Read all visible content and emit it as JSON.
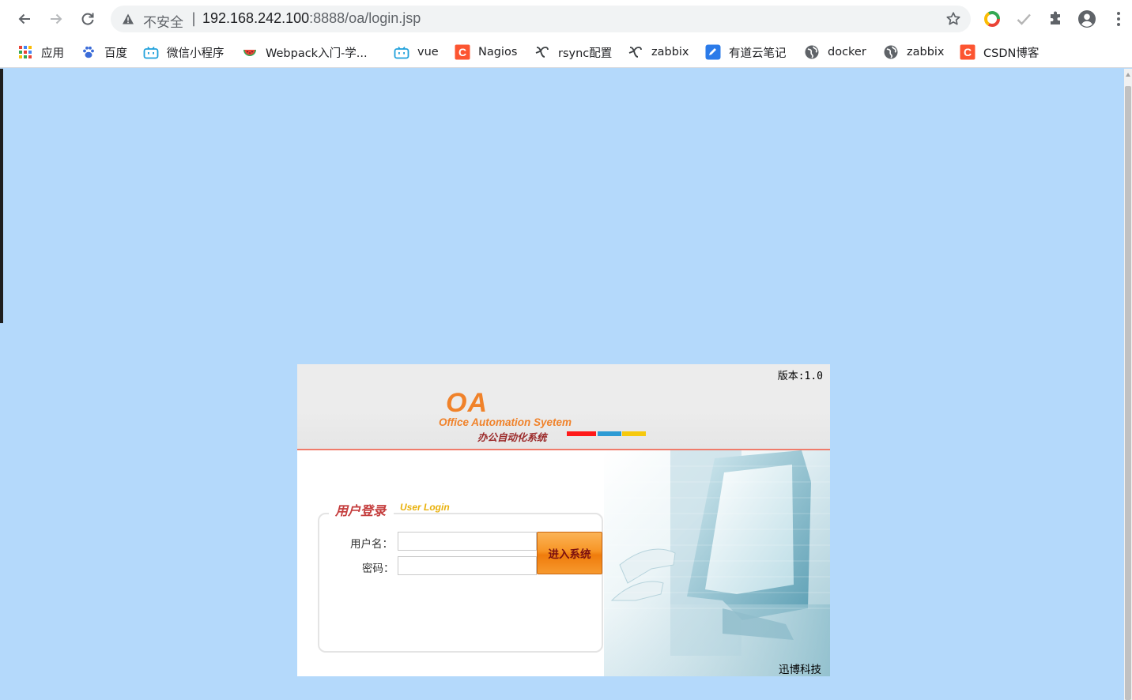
{
  "browser": {
    "security_label": "不安全",
    "separator": "|",
    "url_host": "192.168.242.100",
    "url_rest": ":8888/oa/login.jsp"
  },
  "bookmarks": [
    {
      "label": "应用",
      "icon": "apps-grid-icon"
    },
    {
      "label": "百度",
      "icon": "baidu-paw-icon"
    },
    {
      "label": "微信小程序",
      "icon": "bilibili-tv-icon"
    },
    {
      "label": "Webpack入门-学...",
      "icon": "watermelon-icon"
    },
    {
      "label": "vue",
      "icon": "bilibili-tv-icon"
    },
    {
      "label": "Nagios",
      "icon": "csdn-c-icon"
    },
    {
      "label": "rsync配置",
      "icon": "linux-zeal-icon"
    },
    {
      "label": "zabbix",
      "icon": "linux-zeal-icon"
    },
    {
      "label": "有道云笔记",
      "icon": "youdao-note-icon"
    },
    {
      "label": "docker",
      "icon": "globe-icon"
    },
    {
      "label": "zabbix",
      "icon": "globe-icon"
    },
    {
      "label": "CSDN博客",
      "icon": "csdn-c-icon"
    }
  ],
  "login": {
    "version": "版本:1.0",
    "logo_text": "OA",
    "logo_subtitle_en": "Office Automation Syetem",
    "logo_subtitle_cn": "办公自动化系统",
    "title_cn": "用户登录",
    "title_en": "User Login",
    "username_label": "用户名：",
    "password_label": "密码：",
    "username_value": "",
    "password_value": "",
    "submit_label": "进入系统",
    "company": "迅博科技"
  },
  "colors": {
    "page_background": "#b4d9fb",
    "logo_orange": "#f0822a",
    "accent_red": "#ff1a1a",
    "accent_blue": "#2d9bd4",
    "accent_yellow": "#f6c90e",
    "button_orange": "#f79526"
  }
}
